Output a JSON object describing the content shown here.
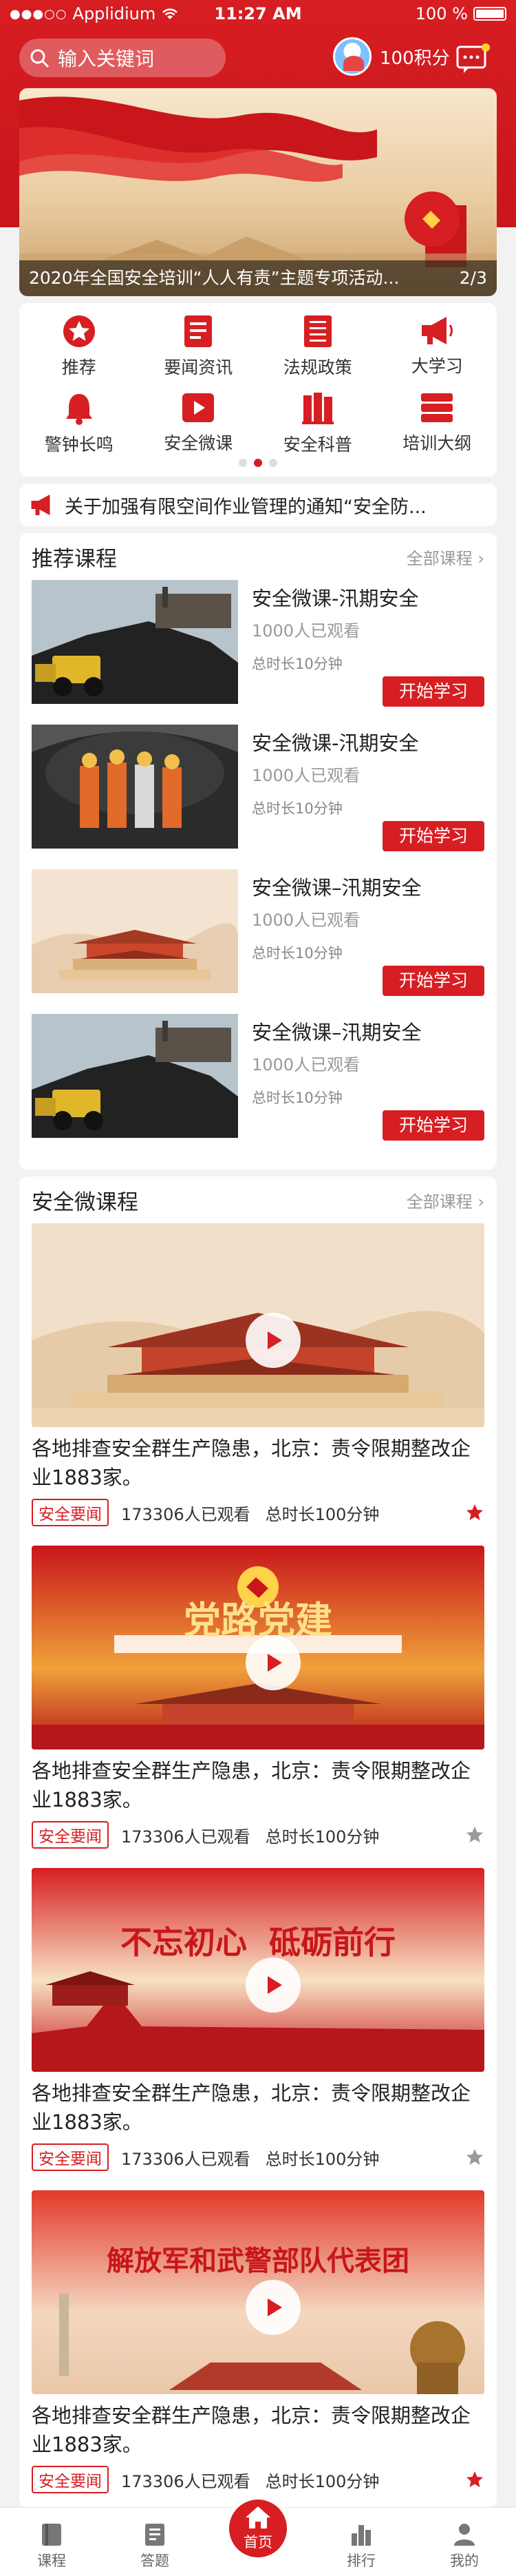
{
  "status": {
    "carrier": "Applidium",
    "time": "11:27 AM",
    "battery": "100 %"
  },
  "header": {
    "search_placeholder": "输入关键词",
    "points": "100积分"
  },
  "banner": {
    "caption": "2020年全国安全培训“人人有责”主题专项活动...",
    "pager": "2/3"
  },
  "menu": {
    "items": [
      {
        "label": "推荐",
        "icon": "star-icon"
      },
      {
        "label": "要闻资讯",
        "icon": "news-icon"
      },
      {
        "label": "法规政策",
        "icon": "law-icon"
      },
      {
        "label": "大学习",
        "icon": "megaphone-icon"
      },
      {
        "label": "警钟长鸣",
        "icon": "bell-icon"
      },
      {
        "label": "安全微课",
        "icon": "video-icon"
      },
      {
        "label": "安全科普",
        "icon": "books-icon"
      },
      {
        "label": "培训大纲",
        "icon": "list-icon"
      }
    ],
    "page_count": 3,
    "active_page": 2
  },
  "notice": {
    "text": "关于加强有限空间作业管理的通知“安全防..."
  },
  "recommended": {
    "title": "推荐课程",
    "more": "全部课程",
    "courses": [
      {
        "title": "安全微课-汛期安全",
        "views": "1000人已观看",
        "duration": "总时长10分钟",
        "button": "开始学习",
        "thumb": "coal"
      },
      {
        "title": "安全微课-汛期安全",
        "views": "1000人已观看",
        "duration": "总时长10分钟",
        "button": "开始学习",
        "thumb": "mine"
      },
      {
        "title": "安全微课–汛期安全",
        "views": "1000人已观看",
        "duration": "总时长10分钟",
        "button": "开始学习",
        "thumb": "palace"
      },
      {
        "title": "安全微课–汛期安全",
        "views": "1000人已观看",
        "duration": "总时长10分钟",
        "button": "开始学习",
        "thumb": "coal"
      }
    ]
  },
  "micro": {
    "title": "安全微课程",
    "more": "全部课程",
    "videos": [
      {
        "title": "各地排查安全群生产隐患，北京：责令限期整改企业1883家。",
        "tag": "安全要闻",
        "views": "173306人已观看",
        "duration": "总时长100分钟",
        "starred": true,
        "art": "palace",
        "art_text": ""
      },
      {
        "title": "各地排查安全群生产隐患，北京：责令限期整改企业1883家。",
        "tag": "安全要闻",
        "views": "173306人已观看",
        "duration": "总时长100分钟",
        "starred": false,
        "art": "party",
        "art_text": "党路党建"
      },
      {
        "title": "各地排查安全群生产隐患，北京：责令限期整改企业1883家。",
        "tag": "安全要闻",
        "views": "173306人已观看",
        "duration": "总时长100分钟",
        "starred": false,
        "art": "red",
        "art_text": "不忘初心  砥砺前行"
      },
      {
        "title": "各地排查安全群生产隐患，北京：责令限期整改企业1883家。",
        "tag": "安全要闻",
        "views": "173306人已观看",
        "duration": "总时长100分钟",
        "starred": true,
        "art": "army",
        "art_text": "解放军和武警部队代表团"
      }
    ]
  },
  "tabbar": {
    "items": [
      {
        "label": "课程",
        "icon": "book-icon"
      },
      {
        "label": "答题",
        "icon": "quiz-icon"
      },
      {
        "label": "首页",
        "icon": "home-icon"
      },
      {
        "label": "排行",
        "icon": "rank-icon"
      },
      {
        "label": "我的",
        "icon": "user-icon"
      }
    ],
    "active": 2
  },
  "colors": {
    "primary": "#d71e22",
    "star_on": "#d71e22",
    "star_off": "#9a9a9a"
  }
}
